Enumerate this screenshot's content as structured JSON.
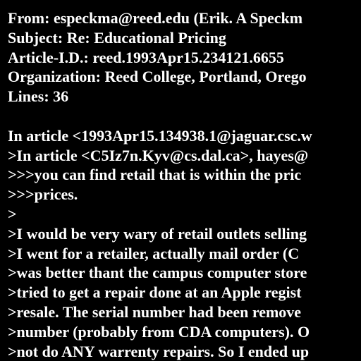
{
  "header": {
    "from": "From: especkma@reed.edu (Erik. A Speckm",
    "subject": "Subject: Re: Educational Pricing",
    "article_id": "Article-I.D.: reed.1993Apr15.234121.6655",
    "organization": "Organization: Reed College, Portland, Orego",
    "lines": "Lines: 36"
  },
  "body": [
    "In article <1993Apr15.134938.1@jaguar.csc.w",
    ">In article <C5Iz7n.Kyv@cs.dal.ca>, hayes@",
    ">>>you can find retail that is within the pric",
    ">>>prices.",
    ">",
    ">I would be very wary of retail outlets selling",
    ">I went for a retailer, actually mail order (C",
    ">was better thant the campus computer store",
    ">tried to get a repair done at an Apple regist",
    ">resale. The serial number had been remove",
    ">number (probably from CDA computers). O",
    ">not do ANY warrenty repairs. So I ended up"
  ],
  "colors": {
    "background": "#000000",
    "text": "#ffffff"
  }
}
